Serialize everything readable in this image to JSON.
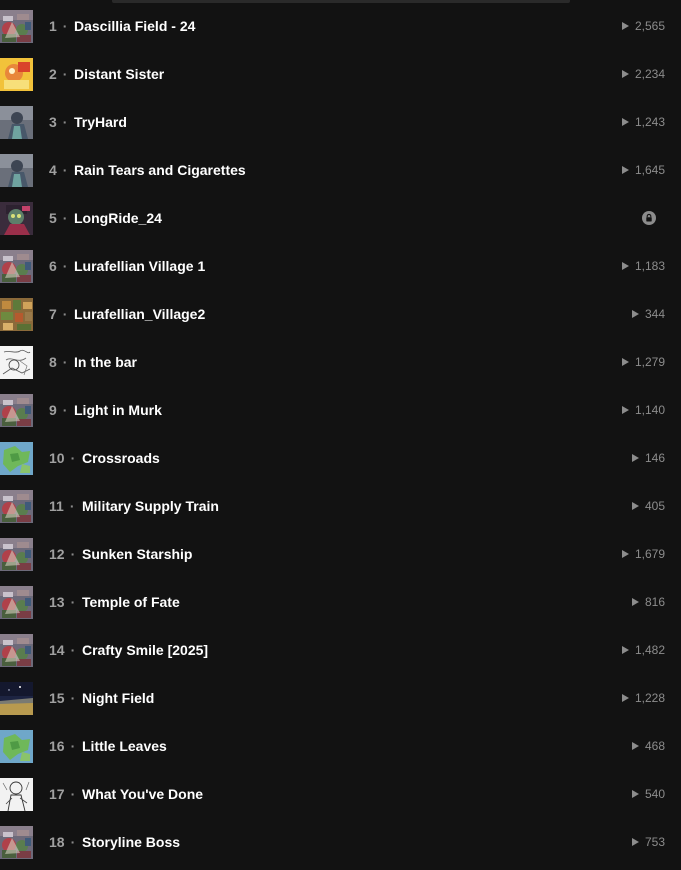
{
  "separator": "·",
  "tracks": [
    {
      "number": "1",
      "title": "Dascillia Field - 24",
      "plays": "2,565",
      "art": "collage",
      "locked": false
    },
    {
      "number": "2",
      "title": "Distant Sister",
      "plays": "2,234",
      "art": "warm",
      "locked": false
    },
    {
      "number": "3",
      "title": "TryHard",
      "plays": "1,243",
      "art": "figure",
      "locked": false
    },
    {
      "number": "4",
      "title": "Rain Tears and Cigarettes",
      "plays": "1,645",
      "art": "figure",
      "locked": false
    },
    {
      "number": "5",
      "title": "LongRide_24",
      "plays": "",
      "art": "character",
      "locked": true
    },
    {
      "number": "6",
      "title": "Lurafellian Village 1",
      "plays": "1,183",
      "art": "collage",
      "locked": false
    },
    {
      "number": "7",
      "title": "Lurafellian_Village2",
      "plays": "344",
      "art": "village",
      "locked": false
    },
    {
      "number": "8",
      "title": "In the bar",
      "plays": "1,279",
      "art": "sketch",
      "locked": false
    },
    {
      "number": "9",
      "title": "Light in Murk",
      "plays": "1,140",
      "art": "collage",
      "locked": false
    },
    {
      "number": "10",
      "title": "Crossroads",
      "plays": "146",
      "art": "map",
      "locked": false
    },
    {
      "number": "11",
      "title": "Military Supply Train",
      "plays": "405",
      "art": "collage",
      "locked": false
    },
    {
      "number": "12",
      "title": "Sunken Starship",
      "plays": "1,679",
      "art": "collage",
      "locked": false
    },
    {
      "number": "13",
      "title": "Temple of Fate",
      "plays": "816",
      "art": "collage",
      "locked": false
    },
    {
      "number": "14",
      "title": "Crafty Smile [2025]",
      "plays": "1,482",
      "art": "collage",
      "locked": false
    },
    {
      "number": "15",
      "title": "Night Field",
      "plays": "1,228",
      "art": "night",
      "locked": false
    },
    {
      "number": "16",
      "title": "Little Leaves",
      "plays": "468",
      "art": "map",
      "locked": false
    },
    {
      "number": "17",
      "title": "What You've Done",
      "plays": "540",
      "art": "sketch2",
      "locked": false
    },
    {
      "number": "18",
      "title": "Storyline Boss",
      "plays": "753",
      "art": "collage",
      "locked": false
    }
  ]
}
